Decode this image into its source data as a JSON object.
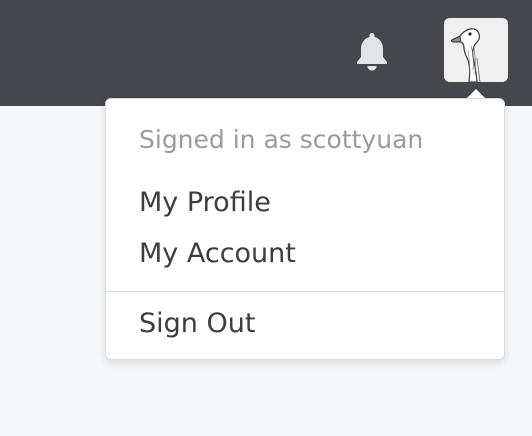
{
  "topbar": {
    "bell_icon": "bell-icon",
    "avatar_icon": "goose-avatar-icon",
    "background_color": "#46474c"
  },
  "user_menu": {
    "header": "Signed in as scottyuan",
    "items": [
      {
        "label": "My Profile"
      },
      {
        "label": "My Account"
      }
    ],
    "sign_out_label": "Sign Out"
  }
}
